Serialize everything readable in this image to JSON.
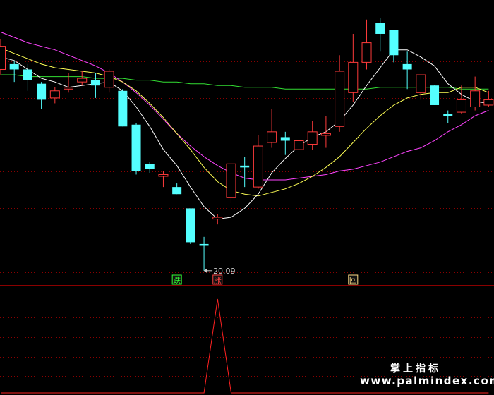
{
  "chart_data": [
    {
      "type": "candlestick",
      "panel": "price",
      "colors": {
        "up": "#ff3b3b",
        "down": "#54ffff",
        "ma_fast": "#ffffff",
        "ma_mid": "#ffff55",
        "ma_slow": "#ff44ff",
        "ma_long": "#33dd33",
        "grid": "#8a0000"
      },
      "candles": [
        {
          "o": 26.6,
          "c": 27.9,
          "h": 28.3,
          "l": 26.3
        },
        {
          "o": 26.9,
          "c": 26.6,
          "h": 27.1,
          "l": 25.9
        },
        {
          "o": 26.6,
          "c": 26.0,
          "h": 26.9,
          "l": 25.4
        },
        {
          "o": 25.8,
          "c": 24.9,
          "h": 25.9,
          "l": 24.4
        },
        {
          "o": 25.0,
          "c": 25.4,
          "h": 25.6,
          "l": 24.7
        },
        {
          "o": 25.5,
          "c": 25.6,
          "h": 26.4,
          "l": 25.3
        },
        {
          "o": 25.9,
          "c": 26.1,
          "h": 26.5,
          "l": 25.7
        },
        {
          "o": 26.0,
          "c": 25.7,
          "h": 26.4,
          "l": 25.0
        },
        {
          "o": 25.6,
          "c": 26.5,
          "h": 26.6,
          "l": 25.3
        },
        {
          "o": 25.4,
          "c": 23.4,
          "h": 25.5,
          "l": 23.4
        },
        {
          "o": 23.5,
          "c": 20.9,
          "h": 23.6,
          "l": 20.7
        },
        {
          "o": 21.3,
          "c": 21.0,
          "h": 21.4,
          "l": 20.8
        },
        {
          "o": 20.6,
          "c": 20.7,
          "h": 20.9,
          "l": 20.0
        },
        {
          "o": 20.0,
          "c": 19.6,
          "h": 20.2,
          "l": 19.6
        },
        {
          "o": 18.8,
          "c": 16.9,
          "h": 18.8,
          "l": 16.8
        },
        {
          "o": 16.8,
          "c": 16.7,
          "h": 17.2,
          "l": 15.3
        },
        {
          "o": 18.2,
          "c": 18.3,
          "h": 18.5,
          "l": 17.9
        },
        {
          "o": 19.4,
          "c": 21.3,
          "h": 21.3,
          "l": 19.1
        },
        {
          "o": 21.2,
          "c": 21.1,
          "h": 21.7,
          "l": 20.0
        },
        {
          "o": 20.0,
          "c": 22.3,
          "h": 22.9,
          "l": 19.9
        },
        {
          "o": 22.5,
          "c": 23.1,
          "h": 24.4,
          "l": 22.2
        },
        {
          "o": 22.8,
          "c": 22.6,
          "h": 23.1,
          "l": 21.8
        },
        {
          "o": 22.1,
          "c": 22.6,
          "h": 23.8,
          "l": 21.6
        },
        {
          "o": 22.4,
          "c": 23.1,
          "h": 23.7,
          "l": 22.1
        },
        {
          "o": 22.9,
          "c": 23.0,
          "h": 24.0,
          "l": 22.2
        },
        {
          "o": 23.4,
          "c": 26.5,
          "h": 27.4,
          "l": 23.1
        },
        {
          "o": 25.3,
          "c": 27.0,
          "h": 28.6,
          "l": 24.8
        },
        {
          "o": 27.0,
          "c": 28.1,
          "h": 29.4,
          "l": 26.6
        },
        {
          "o": 29.2,
          "c": 28.6,
          "h": 29.5,
          "l": 27.6
        },
        {
          "o": 28.8,
          "c": 27.4,
          "h": 28.8,
          "l": 27.0
        },
        {
          "o": 26.9,
          "c": 26.6,
          "h": 27.6,
          "l": 25.5
        },
        {
          "o": 25.3,
          "c": 26.3,
          "h": 26.3,
          "l": 24.9
        },
        {
          "o": 25.7,
          "c": 24.6,
          "h": 25.7,
          "l": 24.6
        },
        {
          "o": 24.1,
          "c": 24.0,
          "h": 24.3,
          "l": 23.6
        },
        {
          "o": 24.2,
          "c": 24.9,
          "h": 25.7,
          "l": 24.1
        },
        {
          "o": 24.5,
          "c": 25.4,
          "h": 26.2,
          "l": 24.3
        },
        {
          "o": 24.6,
          "c": 24.9,
          "h": 25.4,
          "l": 24.5
        }
      ],
      "ma_fast": [
        27.3,
        27.1,
        26.6,
        26.1,
        25.9,
        25.6,
        25.7,
        25.8,
        25.9,
        25.4,
        24.5,
        23.4,
        22.1,
        21.2,
        20.0,
        18.9,
        18.2,
        18.3,
        18.8,
        19.6,
        20.8,
        21.6,
        22.3,
        22.8,
        23.1,
        23.7,
        24.6,
        25.7,
        26.7,
        27.7,
        27.7,
        27.3,
        26.8,
        25.8,
        25.2,
        24.8,
        24.7
      ],
      "ma_mid": [
        27.8,
        27.5,
        27.2,
        26.9,
        26.7,
        26.6,
        26.5,
        26.4,
        26.2,
        25.9,
        25.4,
        24.7,
        23.9,
        23.0,
        22.1,
        21.1,
        20.3,
        19.8,
        19.6,
        19.5,
        19.7,
        19.9,
        20.2,
        20.6,
        21.1,
        21.7,
        22.5,
        23.3,
        24.0,
        24.6,
        25.0,
        25.2,
        25.3,
        25.3,
        25.6,
        25.6,
        25.3
      ],
      "ma_slow": [
        28.7,
        28.4,
        28.1,
        27.9,
        27.7,
        27.4,
        27.1,
        26.8,
        26.4,
        25.9,
        25.3,
        24.6,
        23.8,
        23.0,
        22.3,
        21.7,
        21.2,
        20.8,
        20.5,
        20.4,
        20.4,
        20.4,
        20.5,
        20.6,
        20.7,
        20.9,
        21.0,
        21.2,
        21.4,
        21.7,
        22.0,
        22.2,
        22.6,
        23.1,
        23.5,
        24.0,
        24.3
      ],
      "ma_long": [
        26.3,
        26.3,
        26.2,
        26.2,
        26.2,
        26.2,
        26.2,
        26.1,
        26.1,
        26.1,
        26.0,
        26.0,
        25.9,
        25.9,
        25.8,
        25.8,
        25.7,
        25.7,
        25.6,
        25.6,
        25.6,
        25.5,
        25.5,
        25.5,
        25.5,
        25.5,
        25.5,
        25.5,
        25.6,
        25.6,
        25.6,
        25.6,
        25.6,
        25.6,
        25.5,
        25.5,
        25.5
      ],
      "ylim": [
        14.5,
        30.5
      ],
      "low_annotation": {
        "index": 15,
        "price": 20.09,
        "label": "20.09"
      },
      "markers": [
        {
          "index": 13,
          "label": "跌",
          "color": "#33ff33"
        },
        {
          "index": 16,
          "label": "涨",
          "color": "#ff4444"
        },
        {
          "index": 26,
          "label": "回",
          "color": "#ffdd88"
        }
      ]
    },
    {
      "type": "line",
      "panel": "indicator",
      "color": "#ff2222",
      "values": [
        0,
        0,
        0,
        0,
        0,
        0,
        0,
        0,
        0,
        0,
        0,
        0,
        0,
        0,
        0,
        0,
        1,
        0,
        0,
        0,
        0,
        0,
        0,
        0,
        0,
        0,
        0,
        0,
        0,
        0,
        0,
        0,
        0,
        0,
        0,
        0,
        0
      ],
      "ylim": [
        0,
        1
      ]
    }
  ],
  "watermark": {
    "title": "掌上指标",
    "url": "www.palmindex.com"
  }
}
